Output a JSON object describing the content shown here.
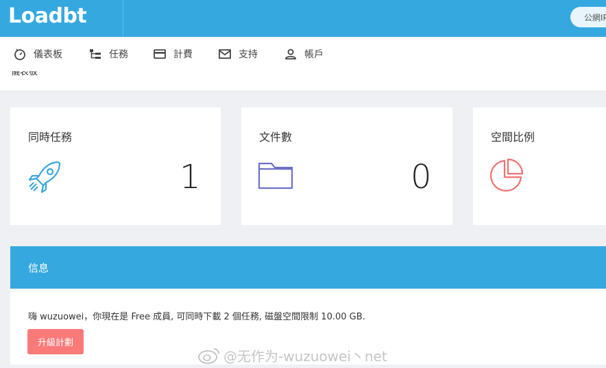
{
  "header": {
    "logo_text": "Loadbt",
    "search_label": "公網IP"
  },
  "nav": {
    "items": [
      {
        "label": "儀表板",
        "icon": "dashboard-gauge-icon"
      },
      {
        "label": "任務",
        "icon": "task-tree-icon"
      },
      {
        "label": "計費",
        "icon": "credit-card-icon"
      },
      {
        "label": "支持",
        "icon": "mail-icon"
      },
      {
        "label": "帳戶",
        "icon": "user-icon"
      }
    ]
  },
  "breadcrumb": "儀表板",
  "cards": [
    {
      "title": "同時任務",
      "value": "1",
      "icon": "rocket-icon",
      "color": "#3aa6e0"
    },
    {
      "title": "文件數",
      "value": "0",
      "icon": "folder-icon",
      "color": "#6b6fc9"
    },
    {
      "title": "空間比例",
      "value": "",
      "icon": "pie-chart-icon",
      "color": "#f07070"
    }
  ],
  "info": {
    "title": "信息",
    "message": "嗨 wuzuowei，你現在是 Free 成員, 可同時下載 2 個任務, 磁盤空間限制 10.00 GB.",
    "upgrade_label": "升級計劃"
  },
  "watermark": "@无作为-wuzuowei丶net",
  "colors": {
    "primary": "#35a8e0",
    "danger_button": "#fa7a7a",
    "background": "#eef0f3"
  }
}
